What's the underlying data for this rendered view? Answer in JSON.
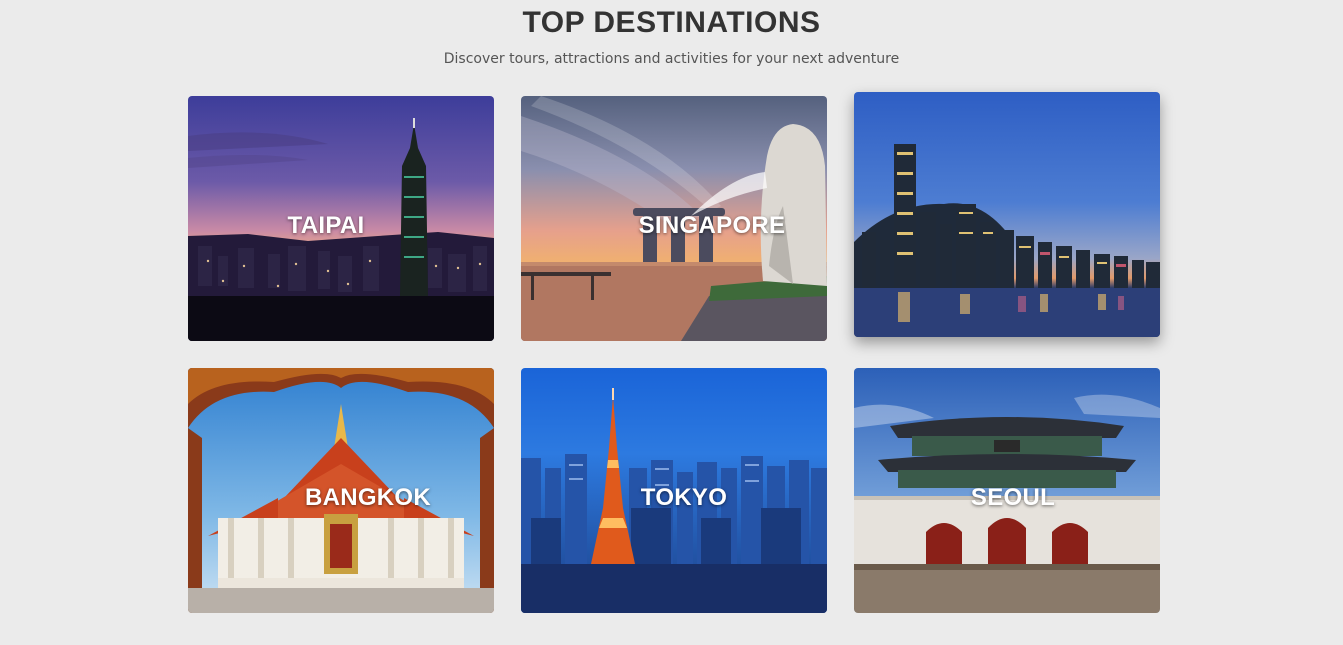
{
  "header": {
    "title": "TOP DESTINATIONS",
    "subtitle": "Discover tours, attractions and activities for your next adventure"
  },
  "destinations": [
    {
      "label": "TAIPAI",
      "image": "taipei-101-skyline-dusk"
    },
    {
      "label": "SINGAPORE",
      "image": "merlion-marina-bay-sunset"
    },
    {
      "label": "",
      "image": "hong-kong-harbour-skyline-dusk"
    },
    {
      "label": "BANGKOK",
      "image": "thai-temple-under-carved-arch"
    },
    {
      "label": "TOKYO",
      "image": "tokyo-tower-blue-cityscape"
    },
    {
      "label": "SEOUL",
      "image": "gwanghwamun-gate"
    }
  ],
  "colors": {
    "background": "#ebebeb",
    "title": "#333333",
    "subtitle": "#555555",
    "card_label": "#ffffff"
  }
}
